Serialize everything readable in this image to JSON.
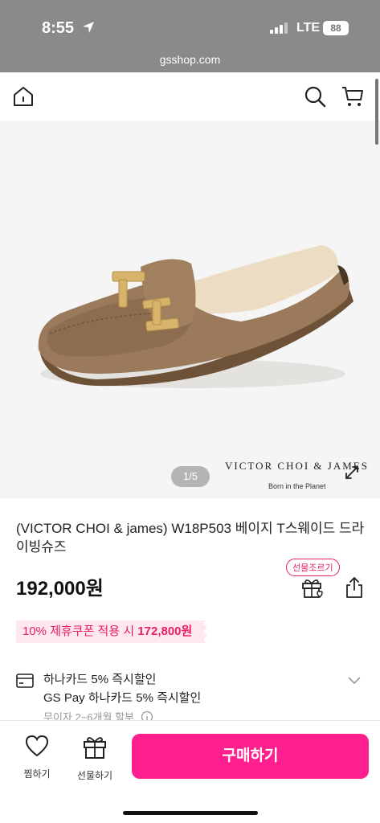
{
  "status_bar": {
    "time": "8:55",
    "network": "LTE",
    "battery": "88",
    "url": "gsshop.com"
  },
  "header": {
    "home_icon": "home-icon",
    "search_icon": "search-icon",
    "cart_icon": "cart-icon"
  },
  "gallery": {
    "counter": "1/5",
    "brand_logo": "VICTOR  CHOI  &  JAMES",
    "brand_tagline": "Born in the Planet",
    "expand_icon": "expand-icon"
  },
  "product": {
    "title": "(VICTOR CHOI & james) W18P503 베이지 T스웨이드 드라이빙슈즈",
    "price": "192,000원",
    "gift_badge": "선물조르기",
    "coupon_prefix": "10% 제휴쿠폰 적용 시 ",
    "coupon_price": "172,800원"
  },
  "benefit": {
    "line1": "하나카드 5% 즉시할인",
    "line2": "GS Pay 하나카드 5% 즉시할인",
    "line3": "무이자 2~6개월 할부"
  },
  "bottom_bar": {
    "wish_label": "찜하기",
    "gift_label": "선물하기",
    "buy_label": "구매하기"
  },
  "colors": {
    "accent": "#ff1f8e",
    "status_bar": "#8a8a8a"
  }
}
